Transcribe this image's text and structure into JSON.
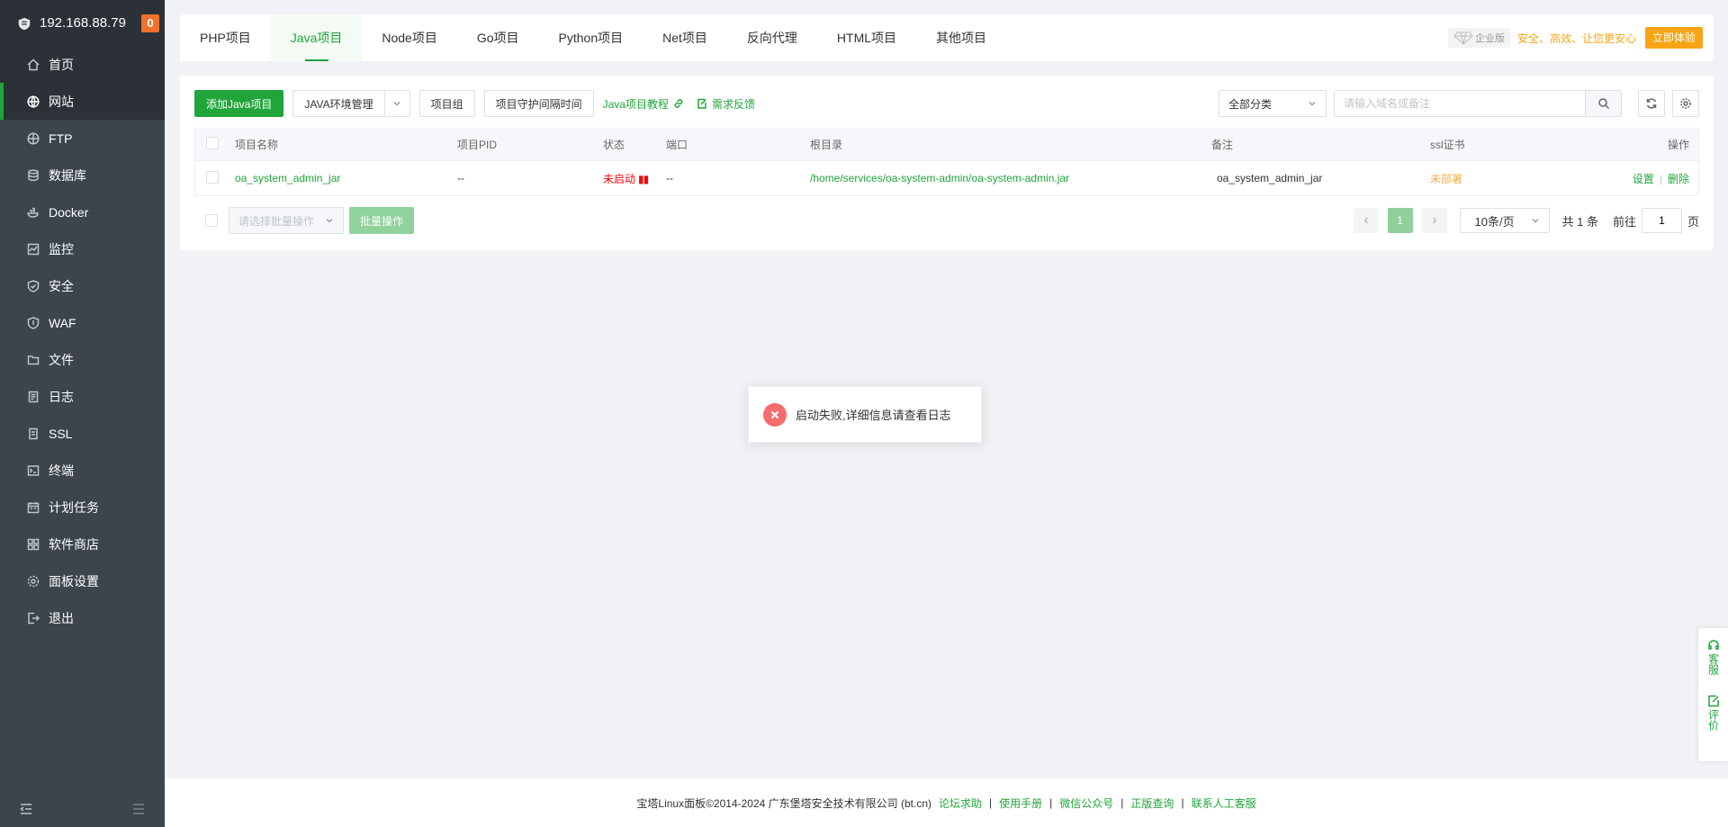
{
  "sidebar": {
    "ip": "192.168.88.79",
    "badge": "0",
    "items": [
      {
        "label": "首页",
        "icon": "home-icon"
      },
      {
        "label": "网站",
        "icon": "globe-icon",
        "active": true
      },
      {
        "label": "FTP",
        "icon": "ftp-icon"
      },
      {
        "label": "数据库",
        "icon": "database-icon"
      },
      {
        "label": "Docker",
        "icon": "docker-icon"
      },
      {
        "label": "监控",
        "icon": "monitor-icon"
      },
      {
        "label": "安全",
        "icon": "shield-icon"
      },
      {
        "label": "WAF",
        "icon": "waf-icon"
      },
      {
        "label": "文件",
        "icon": "folder-icon"
      },
      {
        "label": "日志",
        "icon": "log-icon"
      },
      {
        "label": "SSL",
        "icon": "ssl-icon"
      },
      {
        "label": "终端",
        "icon": "terminal-icon"
      },
      {
        "label": "计划任务",
        "icon": "calendar-icon"
      },
      {
        "label": "软件商店",
        "icon": "store-icon"
      },
      {
        "label": "面板设置",
        "icon": "gear-icon"
      },
      {
        "label": "退出",
        "icon": "logout-icon"
      }
    ]
  },
  "tabs": [
    "PHP项目",
    "Java项目",
    "Node项目",
    "Go项目",
    "Python项目",
    "Net项目",
    "反向代理",
    "HTML项目",
    "其他项目"
  ],
  "promo": {
    "badge": "企业版",
    "text": "安全、高效、让您更安心",
    "button": "立即体验"
  },
  "toolbar": {
    "add_button": "添加Java项目",
    "env_button": "JAVA环境管理",
    "group_button": "项目组",
    "guard_button": "项目守护间隔时间",
    "tutorial_link": "Java项目教程",
    "feedback_link": "需求反馈",
    "category": "全部分类",
    "search_placeholder": "请输入域名或备注"
  },
  "table": {
    "headers": {
      "name": "项目名称",
      "pid": "项目PID",
      "status": "状态",
      "port": "端口",
      "root": "根目录",
      "note": "备注",
      "ssl": "ssl证书",
      "op": "操作"
    },
    "rows": [
      {
        "name": "oa_system_admin_jar",
        "pid": "--",
        "status": "未启动",
        "port": "--",
        "root": "/home/services/oa-system-admin/oa-system-admin.jar",
        "note": "oa_system_admin_jar",
        "ssl": "未部署",
        "op_settings": "设置",
        "op_delete": "删除"
      }
    ]
  },
  "batch": {
    "placeholder": "请选择批量操作",
    "button": "批量操作"
  },
  "pagination": {
    "current": "1",
    "page_size": "10条/页",
    "total": "共 1 条",
    "goto_prefix": "前往",
    "goto_value": "1",
    "goto_suffix": "页"
  },
  "toast": {
    "message": "启动失败,详细信息请查看日志"
  },
  "footer": {
    "copyright": "宝塔Linux面板©2014-2024 广东堡塔安全技术有限公司 (bt.cn)",
    "links": [
      "论坛求助",
      "使用手册",
      "微信公众号",
      "正版查询",
      "联系人工客服"
    ]
  },
  "float_side": {
    "service": "客服",
    "review": "评价"
  },
  "colors": {
    "accent": "#20a53a",
    "sidebar_bg": "#3c444d",
    "error": "#f56c6c",
    "warning": "#f7a516"
  }
}
